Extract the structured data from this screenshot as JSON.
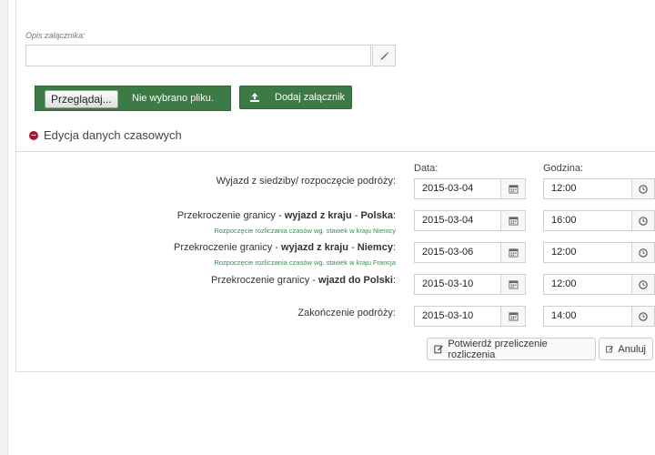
{
  "attachment": {
    "description_label": "Opis załącznika:",
    "description_value": "",
    "browse_label": "Przeglądaj...",
    "no_file_text": "Nie wybrano pliku.",
    "add_label": "Dodaj załącznik"
  },
  "time_section": {
    "title": "Edycja danych czasowych",
    "date_header": "Data:",
    "time_header": "Godzina:",
    "rows": [
      {
        "label_pre": "Wyjazd z siedziby/ rozpoczęcie podróży:",
        "label_bold": "",
        "label_mid": "",
        "label_bold2": "",
        "label_post": "",
        "sub": "",
        "date": "2015-03-04",
        "time": "12:00"
      },
      {
        "label_pre": "Przekroczenie granicy - ",
        "label_bold": "wyjazd z kraju",
        "label_mid": " - ",
        "label_bold2": "Polska",
        "label_post": ":",
        "sub": "Rozpoczęcie rozliczania czasów wg. stawek w kraju Niemcy",
        "date": "2015-03-04",
        "time": "16:00"
      },
      {
        "label_pre": "Przekroczenie granicy - ",
        "label_bold": "wyjazd z kraju",
        "label_mid": " - ",
        "label_bold2": "Niemcy",
        "label_post": ":",
        "sub": "Rozpoczęcie rozliczania czasów wg. stawek w kraju Francja",
        "date": "2015-03-06",
        "time": "12:00"
      },
      {
        "label_pre": "Przekroczenie granicy - ",
        "label_bold": "wjazd do Polski",
        "label_mid": "",
        "label_bold2": "",
        "label_post": ":",
        "sub": "",
        "date": "2015-03-10",
        "time": "12:00"
      },
      {
        "label_pre": "Zakończenie podróży:",
        "label_bold": "",
        "label_mid": "",
        "label_bold2": "",
        "label_post": "",
        "sub": "",
        "date": "2015-03-10",
        "time": "14:00"
      }
    ],
    "confirm_label": "Potwierdź przeliczenie rozliczenia",
    "cancel_label": "Anuluj"
  },
  "icons": {
    "pencil": "pencil-icon",
    "upload": "upload-icon",
    "minus": "minus-circle-icon",
    "calendar": "calendar-icon",
    "clock": "clock-icon",
    "edit": "edit-icon"
  },
  "colors": {
    "primary_green": "#3d7b46",
    "sub_text_green": "#3a8c52",
    "minus_red": "#b3112e"
  }
}
